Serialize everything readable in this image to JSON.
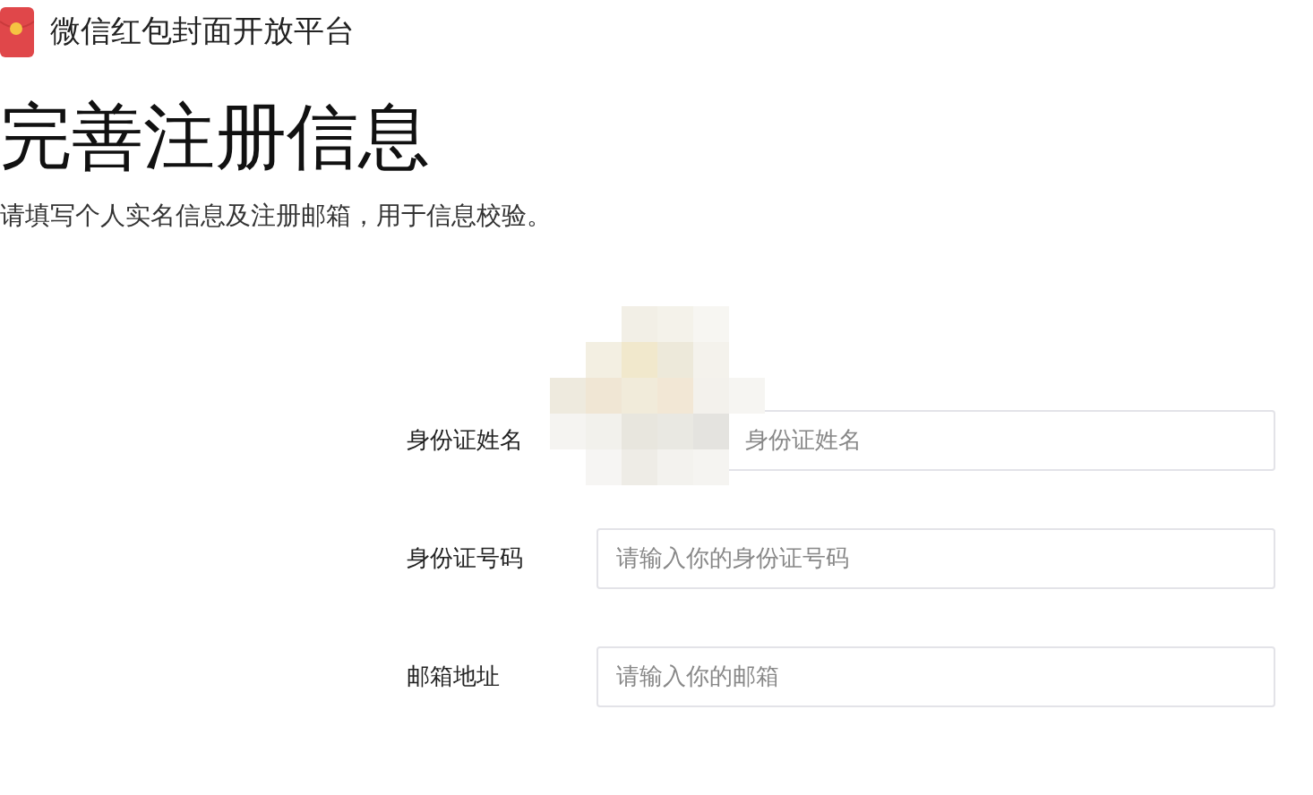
{
  "brand": {
    "name": "微信红包封面开放平台"
  },
  "heading": "完善注册信息",
  "subtitle": "请填写个人实名信息及注册邮箱，用于信息校验。",
  "form": {
    "fields": [
      {
        "label": "身份证姓名",
        "placeholder": "身份证姓名",
        "obscured": true
      },
      {
        "label": "身份证号码",
        "placeholder": "请输入你的身份证号码",
        "obscured": false
      },
      {
        "label": "邮箱地址",
        "placeholder": "请输入你的邮箱",
        "obscured": false
      }
    ]
  }
}
